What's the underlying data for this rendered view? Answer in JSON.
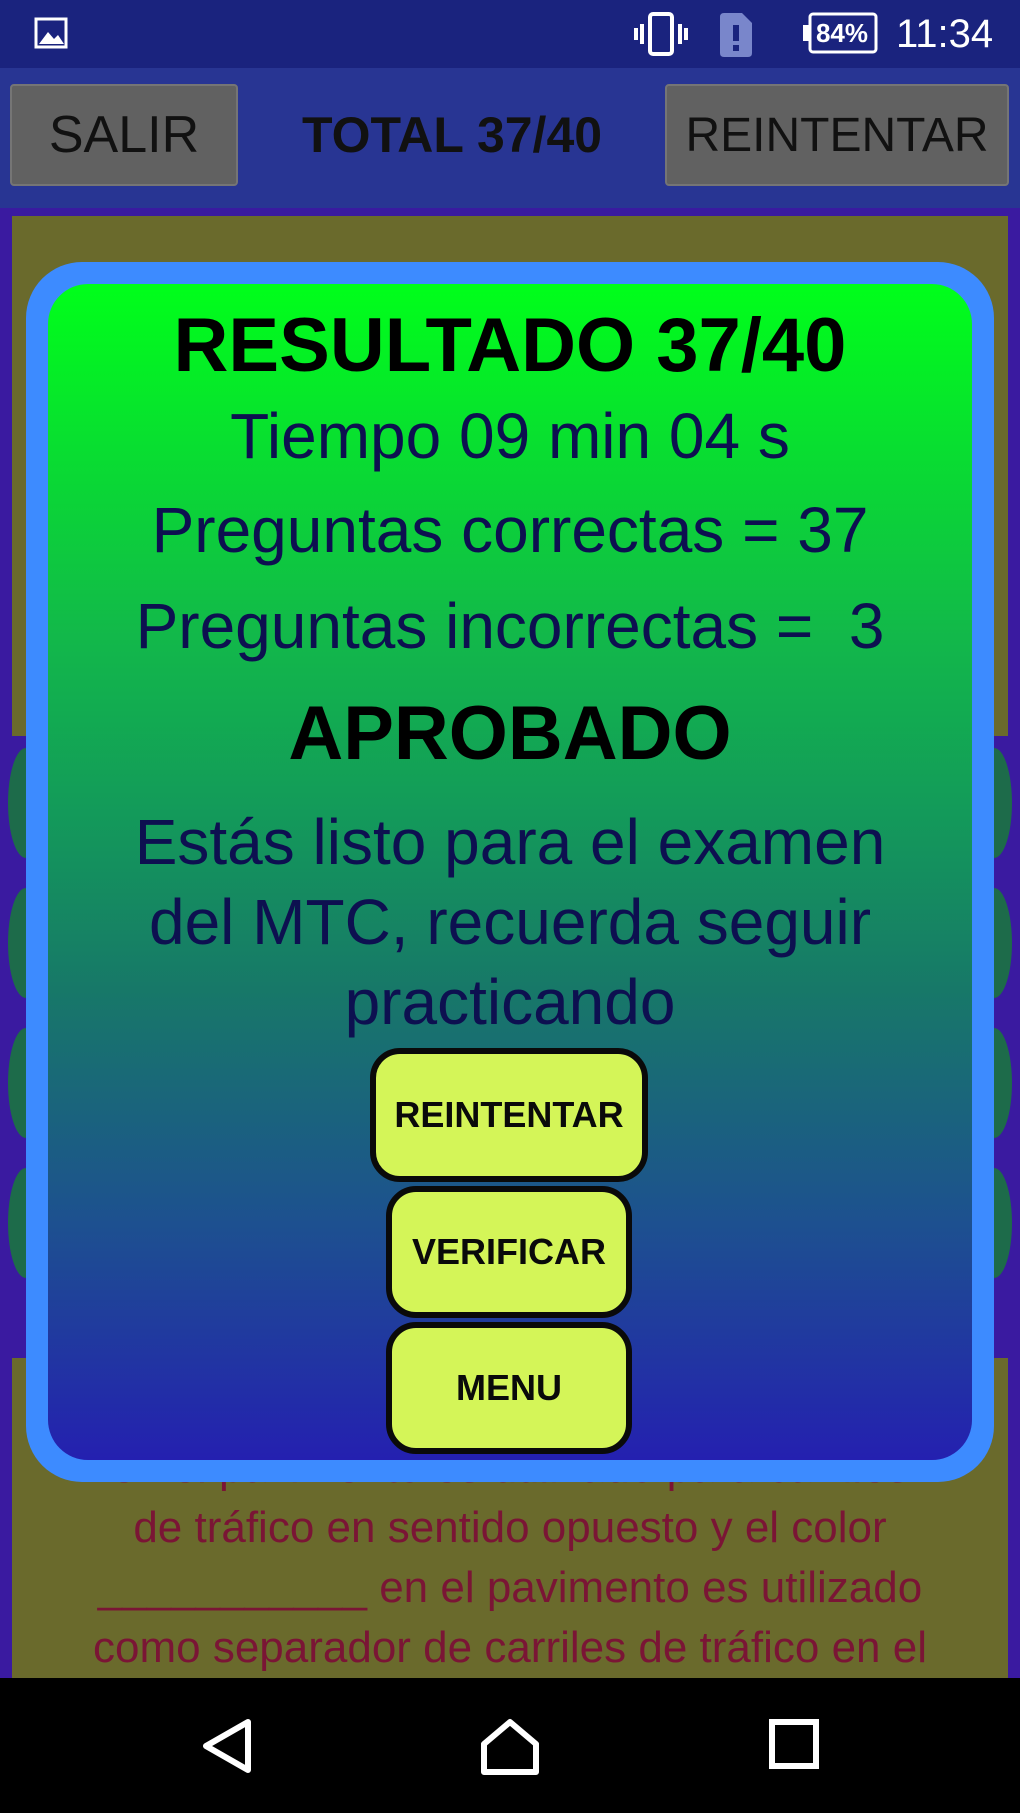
{
  "status_bar": {
    "battery": "84%",
    "time": "11:34",
    "icons": [
      "gallery-icon",
      "vibrate-icon",
      "sim-alert-icon",
      "battery-icon"
    ]
  },
  "toolbar": {
    "exit_label": "SALIR",
    "total_label": "TOTAL 37/40",
    "retry_label": "REINTENTAR"
  },
  "background": {
    "question_fragment_lines": [
      "en el pavimento es utilizado para carriles",
      "de tráfico en sentido opuesto y el color",
      "___________ en el pavimento es utilizado",
      "como separador de carriles de tráfico en el"
    ]
  },
  "dialog": {
    "title": "RESULTADO 37/40",
    "time": "Tiempo 09 min 04 s",
    "correct": "Preguntas correctas = 37",
    "incorrect": "Preguntas incorrectas =  3",
    "status": "APROBADO",
    "message": "Estás listo para el examen del MTC, recuerda seguir practicando",
    "buttons": {
      "retry": "REINTENTAR",
      "verify": "VERIFICAR",
      "menu": "MENU"
    }
  },
  "colors": {
    "status_bar": "#1a237e",
    "toolbar": "#283593",
    "dialog_frame": "#3d8bff",
    "dialog_top": "#00ff1a",
    "dialog_bottom": "#2420b0",
    "button": "#d4f558"
  },
  "navigation": {
    "icons": [
      "back-icon",
      "home-icon",
      "recents-icon"
    ]
  }
}
